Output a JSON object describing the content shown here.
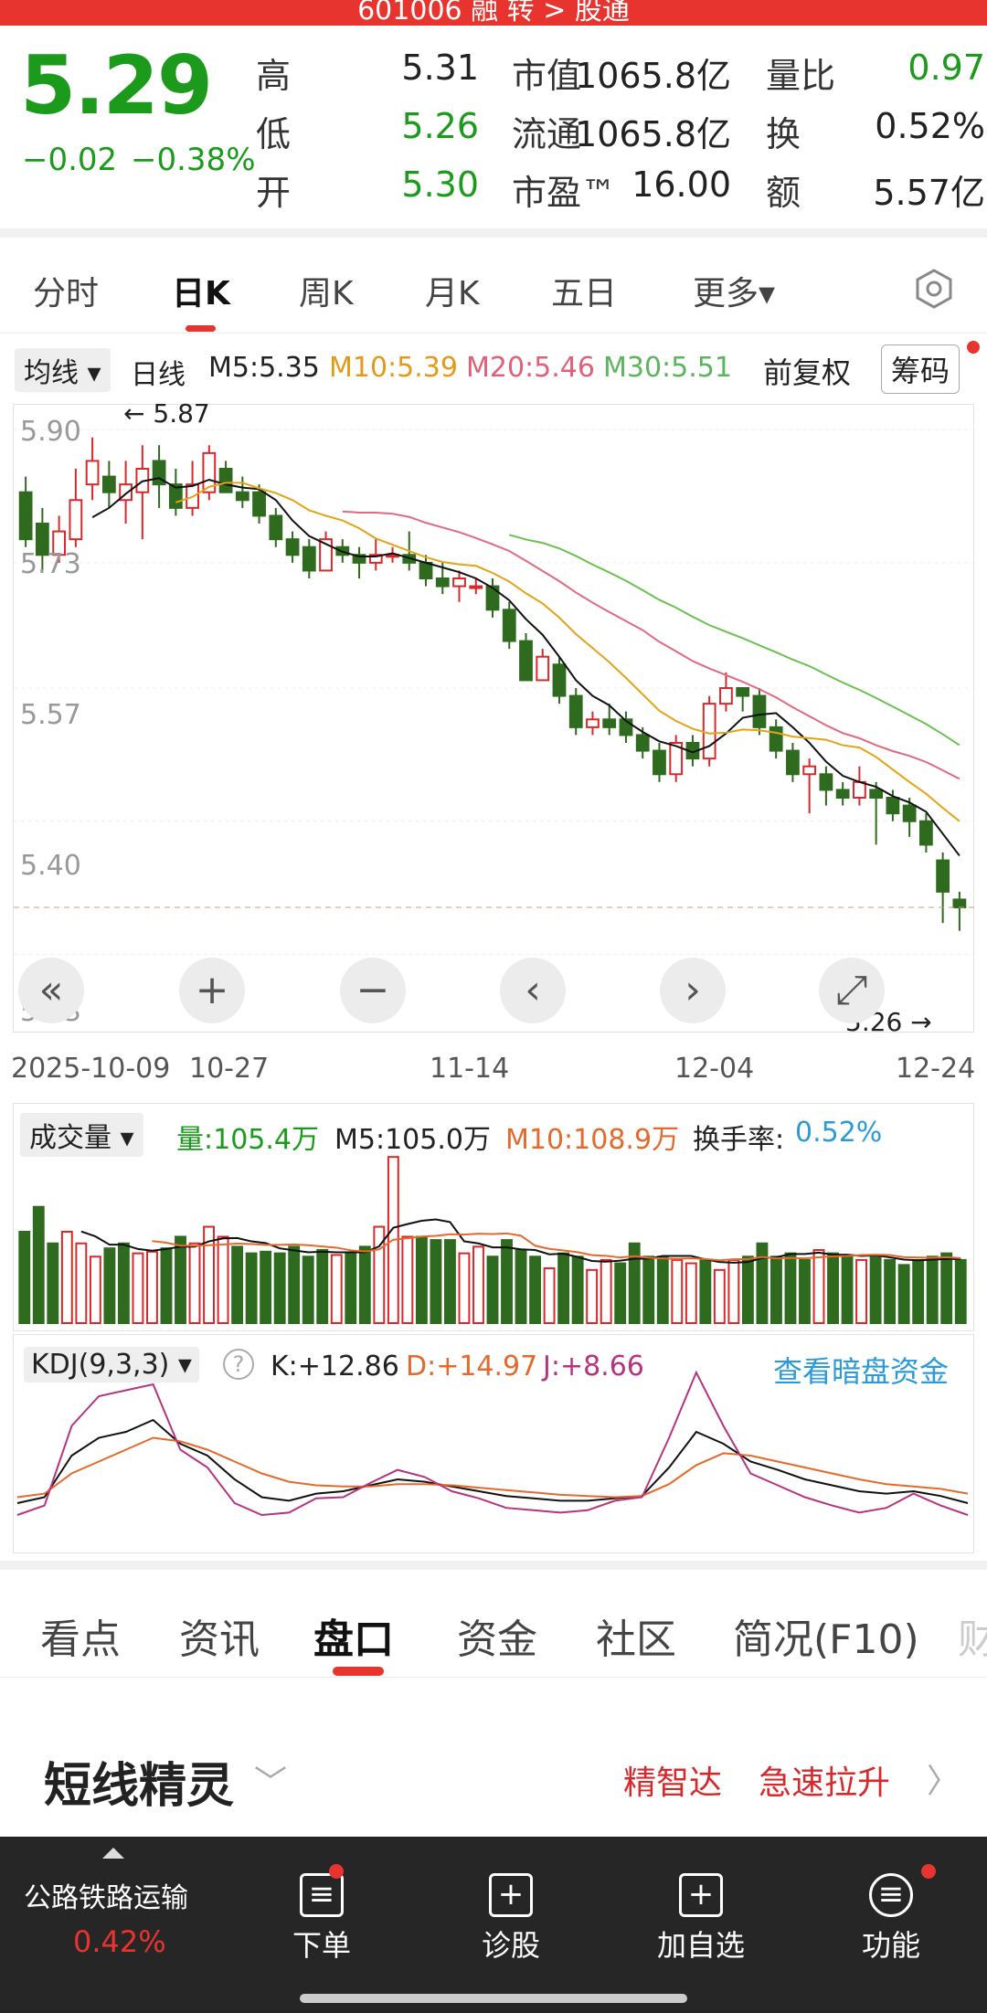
{
  "top_title": "601006 融 转 > 股通",
  "quote": {
    "price": "5.29",
    "change": "−0.02",
    "change_pct": "−0.38%",
    "rows": [
      {
        "l1": "高",
        "v1": "5.31",
        "l2": "市值",
        "v2": "1065.8亿",
        "l3": "量比",
        "v3": "0.97"
      },
      {
        "l1": "低",
        "v1": "5.26",
        "l2": "流通",
        "v2": "1065.8亿",
        "l3": "换",
        "v3": "0.52%"
      },
      {
        "l1": "开",
        "v1": "5.30",
        "l2": "市盈™",
        "v2": "16.00",
        "l3": "额",
        "v3": "5.57亿"
      }
    ]
  },
  "period_tabs": [
    "分时",
    "日K",
    "周K",
    "月K",
    "五日",
    "更多▾"
  ],
  "settings_icon": "hexagon-settings-icon",
  "ma_bar": {
    "ma_btn": "均线 ▾",
    "line": "日线",
    "m5": "M5:5.35",
    "m10": "M10:5.39",
    "m20": "M20:5.46",
    "m30": "M30:5.51",
    "adjust": "前复权",
    "chip": "筹码"
  },
  "colors": {
    "up": "#d7292c",
    "down": "#2e6b1e",
    "m5": "#111111",
    "m10": "#e3a316",
    "m20": "#e06a80",
    "m30": "#6cc052"
  },
  "chart_data": {
    "type": "candlestick",
    "ylabels": [
      "5.90",
      "5.73",
      "5.57",
      "5.40",
      "5.23"
    ],
    "xlabels": [
      "2025-10-09",
      "10-27",
      "11-14",
      "12-04",
      "12-24"
    ],
    "high_mark": "5.87",
    "low_mark": "5.26",
    "ylim": [
      5.22,
      5.92
    ],
    "candles": [
      [
        5.82,
        5.76,
        5.84,
        5.75
      ],
      [
        5.78,
        5.74,
        5.8,
        5.72
      ],
      [
        5.74,
        5.77,
        5.79,
        5.73
      ],
      [
        5.76,
        5.81,
        5.85,
        5.75
      ],
      [
        5.83,
        5.86,
        5.89,
        5.81
      ],
      [
        5.84,
        5.82,
        5.86,
        5.8
      ],
      [
        5.81,
        5.83,
        5.86,
        5.78
      ],
      [
        5.82,
        5.85,
        5.88,
        5.76
      ],
      [
        5.86,
        5.83,
        5.88,
        5.8
      ],
      [
        5.83,
        5.8,
        5.85,
        5.79
      ],
      [
        5.8,
        5.83,
        5.86,
        5.79
      ],
      [
        5.82,
        5.87,
        5.88,
        5.81
      ],
      [
        5.85,
        5.82,
        5.86,
        5.82
      ],
      [
        5.82,
        5.81,
        5.84,
        5.8
      ],
      [
        5.82,
        5.79,
        5.83,
        5.78
      ],
      [
        5.79,
        5.76,
        5.8,
        5.75
      ],
      [
        5.76,
        5.74,
        5.77,
        5.73
      ],
      [
        5.75,
        5.72,
        5.76,
        5.71
      ],
      [
        5.72,
        5.76,
        5.77,
        5.72
      ],
      [
        5.75,
        5.74,
        5.76,
        5.73
      ],
      [
        5.74,
        5.73,
        5.75,
        5.71
      ],
      [
        5.73,
        5.74,
        5.76,
        5.72
      ],
      [
        5.74,
        5.74,
        5.75,
        5.73
      ],
      [
        5.74,
        5.73,
        5.77,
        5.72
      ],
      [
        5.73,
        5.71,
        5.74,
        5.7
      ],
      [
        5.71,
        5.7,
        5.73,
        5.69
      ],
      [
        5.7,
        5.71,
        5.72,
        5.68
      ],
      [
        5.7,
        5.7,
        5.71,
        5.69
      ],
      [
        5.7,
        5.67,
        5.71,
        5.66
      ],
      [
        5.67,
        5.63,
        5.68,
        5.62
      ],
      [
        5.63,
        5.58,
        5.64,
        5.58
      ],
      [
        5.58,
        5.61,
        5.62,
        5.58
      ],
      [
        5.6,
        5.56,
        5.61,
        5.55
      ],
      [
        5.56,
        5.52,
        5.57,
        5.51
      ],
      [
        5.52,
        5.53,
        5.54,
        5.51
      ],
      [
        5.53,
        5.52,
        5.55,
        5.51
      ],
      [
        5.53,
        5.51,
        5.54,
        5.5
      ],
      [
        5.51,
        5.49,
        5.52,
        5.48
      ],
      [
        5.49,
        5.46,
        5.5,
        5.45
      ],
      [
        5.46,
        5.5,
        5.51,
        5.45
      ],
      [
        5.5,
        5.48,
        5.51,
        5.47
      ],
      [
        5.48,
        5.55,
        5.56,
        5.47
      ],
      [
        5.55,
        5.57,
        5.59,
        5.54
      ],
      [
        5.57,
        5.56,
        5.57,
        5.54
      ],
      [
        5.56,
        5.52,
        5.57,
        5.51
      ],
      [
        5.52,
        5.49,
        5.53,
        5.48
      ],
      [
        5.49,
        5.46,
        5.5,
        5.45
      ],
      [
        5.46,
        5.47,
        5.48,
        5.41
      ],
      [
        5.46,
        5.44,
        5.47,
        5.42
      ],
      [
        5.44,
        5.43,
        5.45,
        5.42
      ],
      [
        5.43,
        5.45,
        5.47,
        5.42
      ],
      [
        5.44,
        5.43,
        5.45,
        5.37
      ],
      [
        5.43,
        5.41,
        5.44,
        5.4
      ],
      [
        5.42,
        5.4,
        5.43,
        5.38
      ],
      [
        5.4,
        5.37,
        5.41,
        5.36
      ],
      [
        5.35,
        5.31,
        5.36,
        5.27
      ],
      [
        5.3,
        5.29,
        5.31,
        5.26
      ]
    ]
  },
  "chart_controls": [
    "«",
    "+",
    "−",
    "‹",
    "›",
    "⤢"
  ],
  "volume": {
    "btn": "成交量 ▾",
    "vol": "量:105.4万",
    "m5": "M5:105.0万",
    "m10": "M10:108.9万",
    "turn_label": "换手率:",
    "turn_val": "0.52%",
    "values": [
      55,
      70,
      48,
      55,
      48,
      40,
      45,
      48,
      42,
      43,
      45,
      52,
      48,
      58,
      52,
      46,
      42,
      43,
      42,
      46,
      40,
      44,
      41,
      42,
      46,
      58,
      100,
      52,
      52,
      50,
      50,
      42,
      46,
      40,
      50,
      44,
      40,
      33,
      42,
      40,
      32,
      38,
      36,
      48,
      40,
      40,
      38,
      36,
      38,
      32,
      38,
      40,
      48,
      40,
      42,
      38,
      44,
      42,
      40,
      38,
      40,
      38,
      35,
      38,
      40,
      42,
      38
    ]
  },
  "kdj": {
    "btn": "KDJ(9,3,3) ▾",
    "help": "?",
    "k": "K:+12.86",
    "d": "D:+14.97",
    "j": "J:+8.66",
    "link": "查看暗盘资金"
  },
  "info_tabs": [
    "看点",
    "资讯",
    "盘口",
    "资金",
    "社区",
    "简况(F10)",
    "财"
  ],
  "sprite": {
    "title": "短线精灵",
    "chev": "﹀",
    "tag1": "精智达",
    "tag2": "急速拉升",
    "arrow": "〉"
  },
  "bottom": {
    "sector": "公路铁路运输",
    "sector_pct": "0.42%",
    "items": [
      "下单",
      "诊股",
      "加自选",
      "功能"
    ]
  }
}
